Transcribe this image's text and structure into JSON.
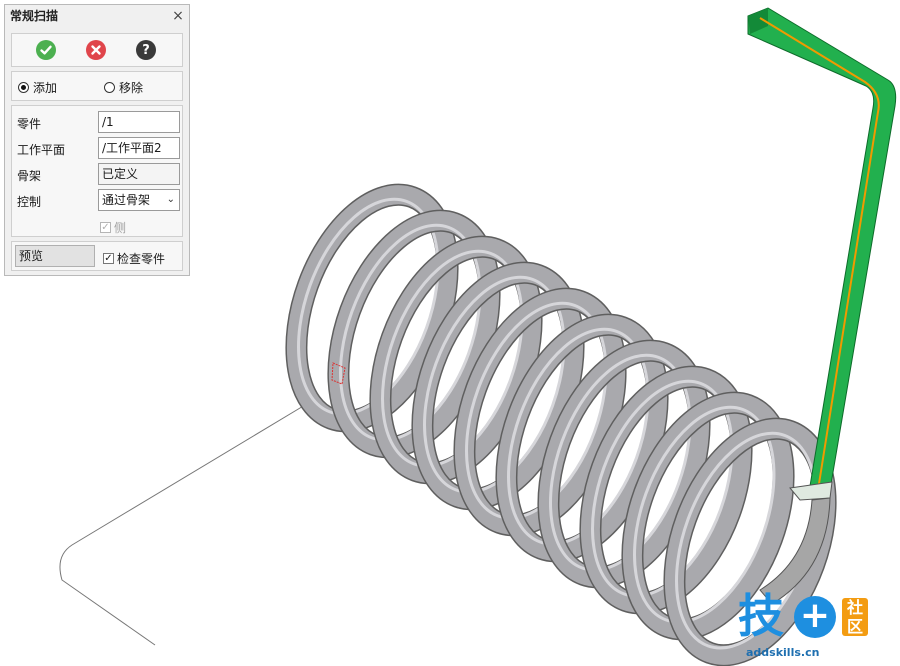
{
  "dialog": {
    "title": "常规扫描",
    "close_glyph": "×",
    "actions": {
      "ok_icon": "check-circle-icon",
      "cancel_icon": "x-circle-icon",
      "help_icon": "question-circle-icon",
      "help_glyph": "?"
    },
    "mode": {
      "add_label": "添加",
      "remove_label": "移除",
      "selected": "add"
    },
    "fields": {
      "part_label": "零件",
      "part_value": "/1",
      "workplane_label": "工作平面",
      "workplane_value": "/工作平面2",
      "skeleton_label": "骨架",
      "skeleton_value": "已定义",
      "control_label": "控制",
      "control_value": "通过骨架"
    },
    "side_label": "侧",
    "preview_label": "预览",
    "check_parts_label": "检查零件",
    "colors": {
      "ok": "#4cb050",
      "cancel": "#e0454b",
      "help": "#3a3a3a",
      "spring": "#9a9a9a",
      "sweep": "#1ea84a",
      "path": "#f09a00"
    }
  },
  "watermark": {
    "big": "技",
    "plus": "+",
    "small_top": "社",
    "small_bottom": "区",
    "url": "addskills.cn"
  }
}
